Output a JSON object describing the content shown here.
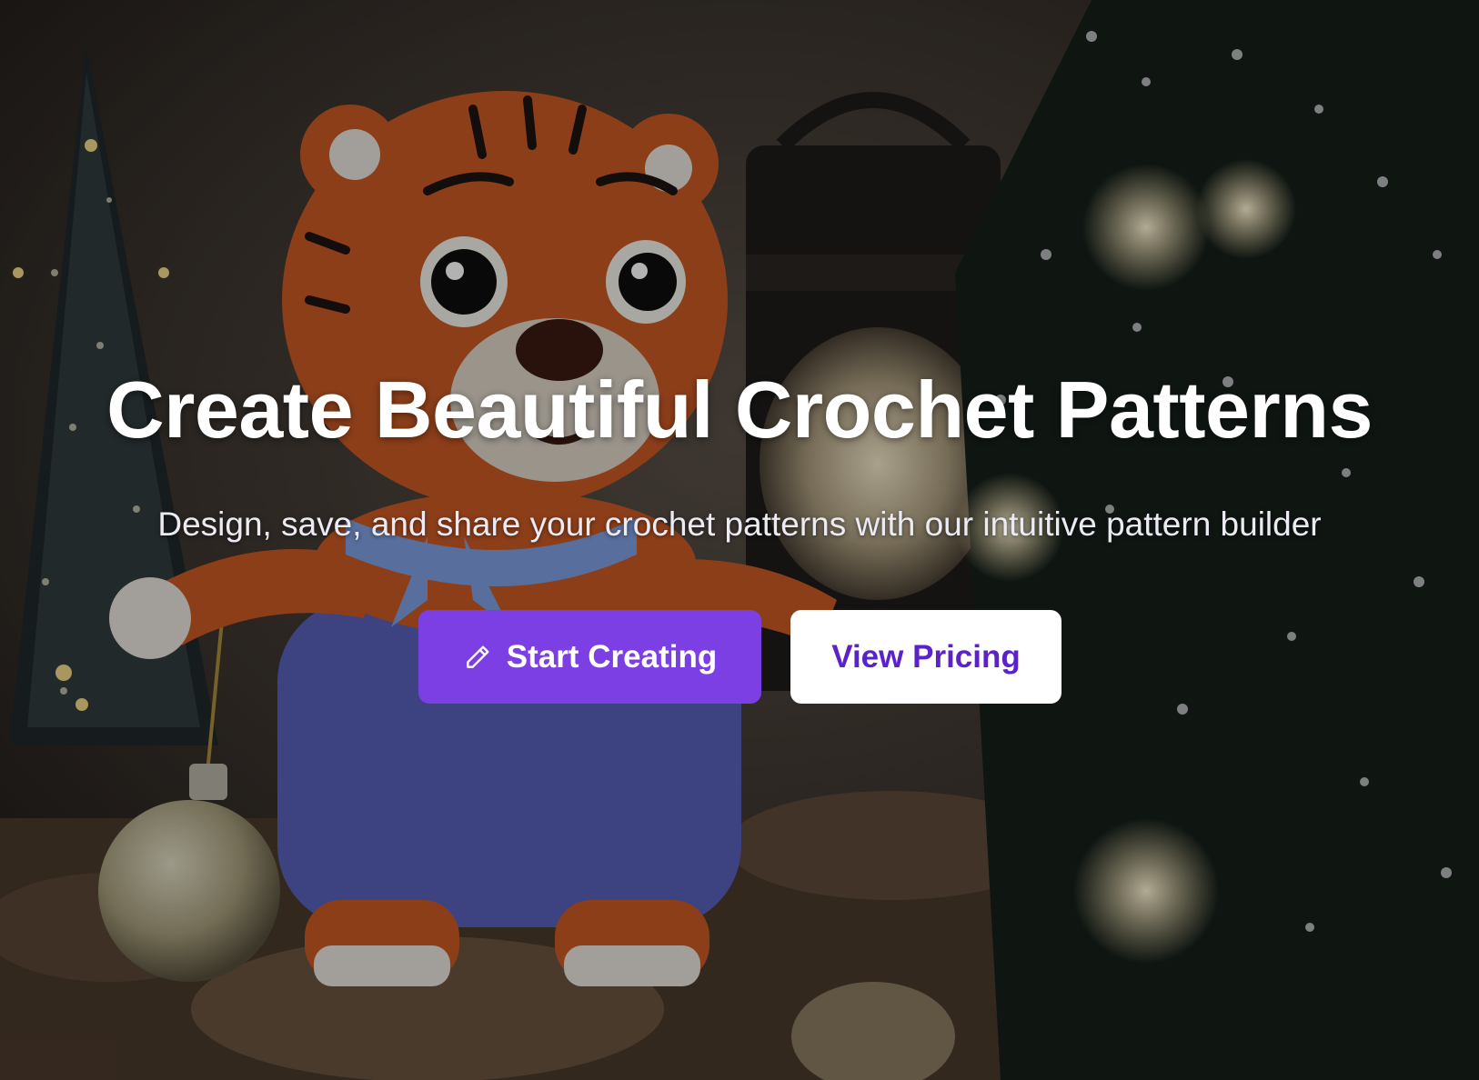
{
  "hero": {
    "title": "Create Beautiful Crochet Patterns",
    "subtitle": "Design, save, and share your crochet patterns with our intuitive pattern builder",
    "primary_button": {
      "label": "Start Creating",
      "icon": "pencil-icon",
      "color": "#7b3fe4"
    },
    "secondary_button": {
      "label": "View Pricing",
      "color": "#ffffff",
      "text_color": "#5a22c8"
    },
    "background_image": "crochet tiger amigurumi with Christmas decorations"
  }
}
